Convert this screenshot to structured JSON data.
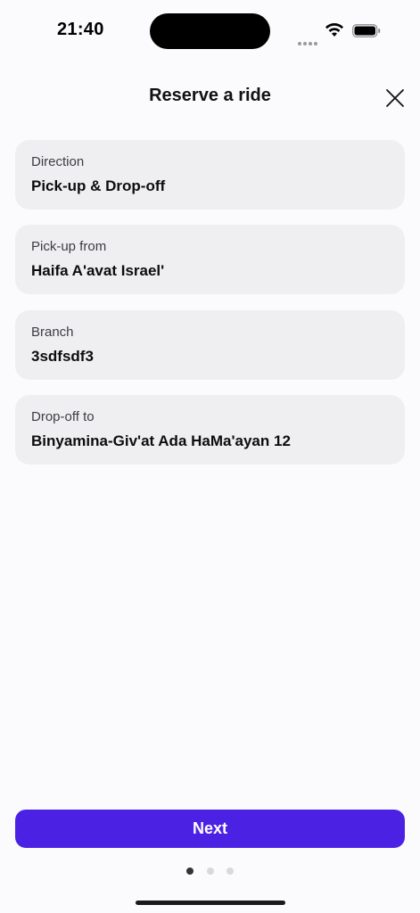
{
  "status_bar": {
    "time": "21:40",
    "icons": [
      "cellular-signal-icon",
      "wifi-icon",
      "battery-icon"
    ]
  },
  "header": {
    "title": "Reserve a ride",
    "close_icon": "close-icon"
  },
  "fields": [
    {
      "label": "Direction",
      "value": "Pick-up & Drop-off"
    },
    {
      "label": "Pick-up from",
      "value": "Haifa A'avat Israel'"
    },
    {
      "label": "Branch",
      "value": "3sdfsdf3"
    },
    {
      "label": "Drop-off to",
      "value": "Binyamina-Giv'at Ada HaMa'ayan 12"
    }
  ],
  "next_button": {
    "label": "Next"
  },
  "pagination": {
    "total_pages": 3,
    "current_page": 1
  },
  "colors": {
    "background": "#fbfbfd",
    "card": "#efeff1",
    "accent": "#4b22e4",
    "dot_active": "#333333",
    "dot_inactive": "#d9d9dd"
  }
}
